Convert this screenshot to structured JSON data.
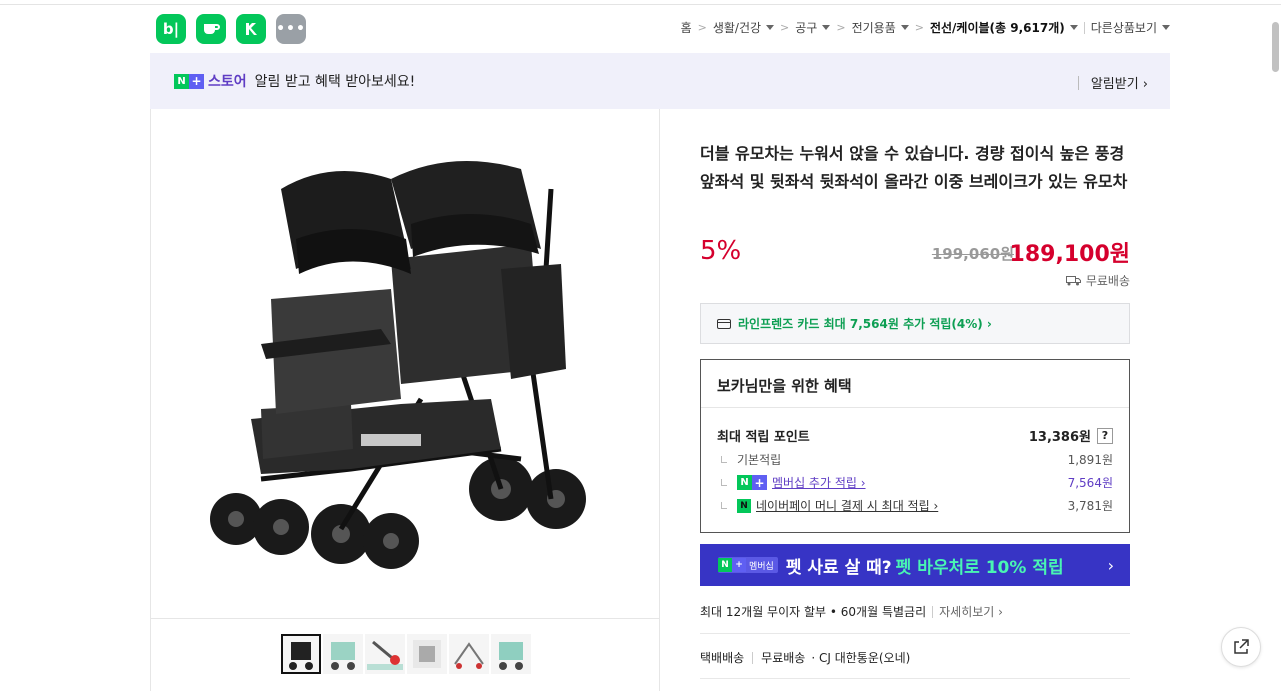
{
  "header": {
    "apps": [
      {
        "icon": "naver-blog-icon",
        "glyph": "b|"
      },
      {
        "icon": "naver-cafe-icon",
        "glyph": "☕"
      },
      {
        "icon": "naver-store-icon",
        "glyph": "◣"
      },
      {
        "icon": "more-apps-icon",
        "glyph": "•••"
      }
    ],
    "breadcrumb": {
      "home": "홈",
      "items": [
        "생활/건강",
        "공구",
        "전기용품"
      ],
      "current": "전선/케이블(총 9,617개)",
      "other": "다른상품보기"
    }
  },
  "store_banner": {
    "badge_n": "N",
    "badge_plus": "+",
    "store_name": "스토어",
    "message": "알림 받고 혜택 받아보세요!",
    "alarm_label": "알림받기 ›"
  },
  "product": {
    "title": "더블 유모차는 누워서 앉을 수 있습니다. 경량 접이식 높은 풍경 앞좌석 및 뒷좌석 뒷좌석이 올라간 이중 브레이크가 있는 유모차",
    "discount": "5%",
    "original_price": "199,060원",
    "sale_price": "189,100원",
    "shipping": "무료배송",
    "card_benefit": "라인프렌즈 카드 최대 7,564원 추가 적립(4%) ›"
  },
  "benefits": {
    "title": "보카님만을 위한 혜택",
    "max_points_label": "최대 적립 포인트",
    "max_points_value": "13,386원",
    "help": "?",
    "basic_label": "기본적립",
    "basic_value": "1,891원",
    "membership_label": "멤버십 추가 적립 ›",
    "membership_value": "7,564원",
    "naverpay_label": "네이버페이 머니 결제 시 최대 적립 ›",
    "naverpay_value": "3,781원"
  },
  "membership_banner": {
    "badge_label": "멤버십",
    "text": "펫 사료 살 때?",
    "accent": "펫 바우처로 10% 적립",
    "arrow": "›"
  },
  "installment": {
    "text": "최대 12개월 무이자 할부 • 60개월 특별금리",
    "detail": "자세히보기 ›"
  },
  "delivery": {
    "type": "택배배송",
    "fee": "무료배송",
    "carrier": "· CJ 대한통운(오네)"
  },
  "colors": {
    "naver_green": "#03c75a",
    "price_red": "#d5002d",
    "membership_blue": "#3734c5",
    "accent_mint": "#49f5b3"
  }
}
